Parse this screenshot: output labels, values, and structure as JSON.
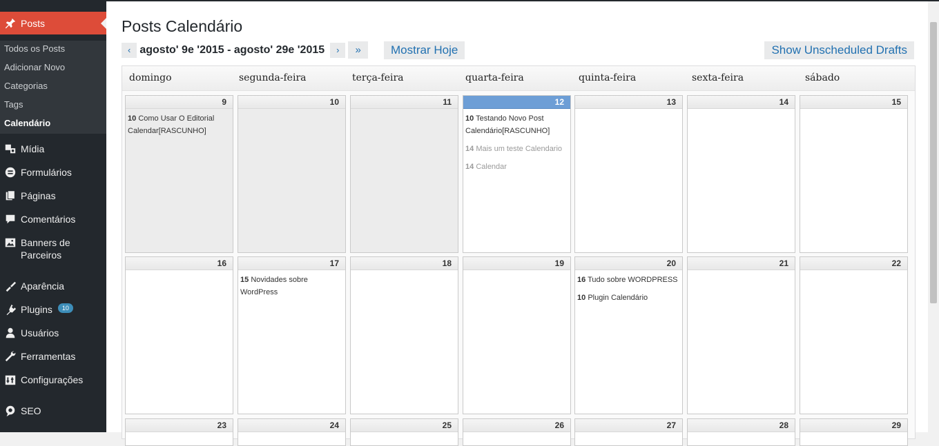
{
  "sidebar": {
    "posts_label": "Posts",
    "submenu": [
      "Todos os Posts",
      "Adicionar Novo",
      "Categorias",
      "Tags",
      "Calendário"
    ],
    "items": [
      {
        "label": "Mídia",
        "icon": "media-icon"
      },
      {
        "label": "Formulários",
        "icon": "forms-icon"
      },
      {
        "label": "Páginas",
        "icon": "pages-icon"
      },
      {
        "label": "Comentários",
        "icon": "comments-icon"
      },
      {
        "label": "Banners de",
        "label2": "Parceiros",
        "icon": "banners-icon"
      },
      {
        "label": "Aparência",
        "icon": "appearance-icon"
      },
      {
        "label": "Plugins",
        "icon": "plugins-icon",
        "badge": "10"
      },
      {
        "label": "Usuários",
        "icon": "users-icon"
      },
      {
        "label": "Ferramentas",
        "icon": "tools-icon"
      },
      {
        "label": "Configurações",
        "icon": "settings-icon"
      },
      {
        "label": "SEO",
        "icon": "seo-icon"
      }
    ]
  },
  "page": {
    "title": "Posts Calendário",
    "prev_label": "‹",
    "range": "agosto' 9e '2015 - agosto' 29e '2015",
    "next_label": "›",
    "jump_label": "»",
    "today_label": "Mostrar Hoje",
    "drafts_label": "Show Unscheduled Drafts"
  },
  "calendar": {
    "weekdays": [
      "domingo",
      "segunda-feira",
      "terça-feira",
      "quarta-feira",
      "quinta-feira",
      "sexta-feira",
      "sábado"
    ],
    "weeks": [
      [
        {
          "day": "9",
          "past": true,
          "posts": [
            {
              "hour": "10",
              "title": "Como Usar O Editorial Calendar[RASCUNHO]"
            }
          ]
        },
        {
          "day": "10",
          "past": true,
          "posts": []
        },
        {
          "day": "11",
          "past": true,
          "posts": []
        },
        {
          "day": "12",
          "today": true,
          "posts": [
            {
              "hour": "10",
              "title": "Testando Novo Post Calendário[RASCUNHO]"
            },
            {
              "hour": "14",
              "title": "Mais um teste Calendario",
              "muted": true
            },
            {
              "hour": "14",
              "title": "Calendar",
              "muted": true
            }
          ]
        },
        {
          "day": "13",
          "posts": []
        },
        {
          "day": "14",
          "posts": []
        },
        {
          "day": "15",
          "posts": []
        }
      ],
      [
        {
          "day": "16",
          "posts": []
        },
        {
          "day": "17",
          "posts": [
            {
              "hour": "15",
              "title": "Novidades sobre WordPress"
            }
          ]
        },
        {
          "day": "18",
          "posts": []
        },
        {
          "day": "19",
          "posts": []
        },
        {
          "day": "20",
          "posts": [
            {
              "hour": "16",
              "title": "Tudo sobre WORDPRESS"
            },
            {
              "hour": "10",
              "title": "Plugin Calendário"
            }
          ]
        },
        {
          "day": "21",
          "posts": []
        },
        {
          "day": "22",
          "posts": []
        }
      ],
      [
        {
          "day": "23",
          "posts": []
        },
        {
          "day": "24",
          "posts": []
        },
        {
          "day": "25",
          "posts": []
        },
        {
          "day": "26",
          "posts": []
        },
        {
          "day": "27",
          "posts": []
        },
        {
          "day": "28",
          "posts": []
        },
        {
          "day": "29",
          "posts": []
        }
      ]
    ]
  }
}
